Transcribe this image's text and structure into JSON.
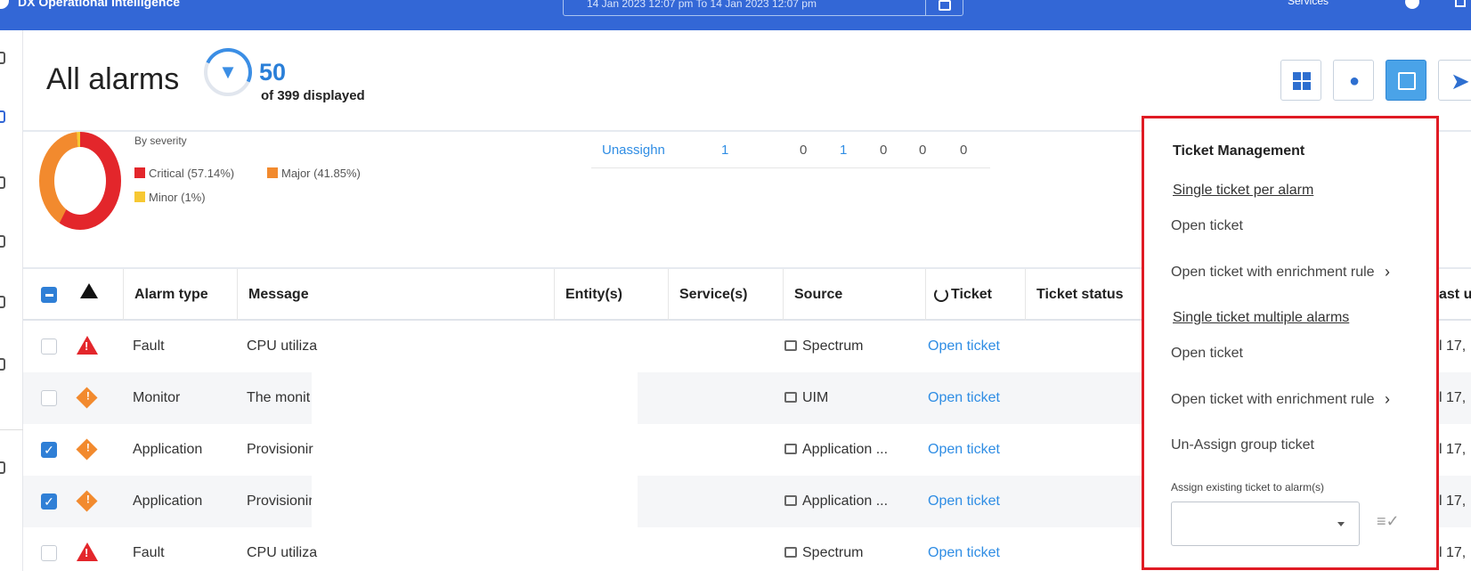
{
  "topbar": {
    "brand": "DX Operational Intelligence",
    "time_range": "14 Jan 2023 12:07 pm    To    14 Jan 2023 12:07 pm",
    "services_link": "Services"
  },
  "header": {
    "title": "All alarms",
    "count": "50",
    "count_caption": "of 399 displayed"
  },
  "summary": {
    "legend_title": "By severity",
    "legend": [
      {
        "label": "Critical (57.14%)",
        "color": "#e3262b"
      },
      {
        "label": "Major (41.85%)",
        "color": "#f28a2e"
      },
      {
        "label": "Minor (1%)",
        "color": "#f7c833"
      }
    ],
    "assign": {
      "label": "Unassighn",
      "values": [
        "1",
        "0",
        "1",
        "0",
        "0",
        "0"
      ]
    }
  },
  "table": {
    "columns": [
      "Alarm type",
      "Message",
      "Entity(s)",
      "Service(s)",
      "Source",
      "Ticket",
      "Ticket status",
      "ast u"
    ],
    "rows": [
      {
        "checked": false,
        "severity": "critical",
        "alarm_type": "Fault",
        "message": "CPU utiliza",
        "source": "Spectrum",
        "ticket": "Open ticket",
        "last": "l 17,"
      },
      {
        "checked": false,
        "severity": "major",
        "alarm_type": "Monitor",
        "message": "The monit",
        "source": "UIM",
        "ticket": "Open ticket",
        "last": "l 17,"
      },
      {
        "checked": true,
        "severity": "major",
        "alarm_type": "Application",
        "message": "Provisionir",
        "source": "Application ...",
        "ticket": "Open ticket",
        "last": "l 17,"
      },
      {
        "checked": true,
        "severity": "major",
        "alarm_type": "Application",
        "message": "Provisionir",
        "source": "Application ...",
        "ticket": "Open ticket",
        "last": "l 17,"
      },
      {
        "checked": false,
        "severity": "critical",
        "alarm_type": "Fault",
        "message": "CPU utiliza",
        "source": "Spectrum",
        "ticket": "Open ticket",
        "last": "l 17,"
      }
    ]
  },
  "ticket_menu": {
    "title": "Ticket Management",
    "section_single": "Single ticket per alarm",
    "open_ticket_1": "Open ticket",
    "open_enrich_1": "Open ticket with enrichment rule",
    "section_multi": "Single ticket multiple alarms",
    "open_ticket_2": "Open ticket",
    "open_enrich_2": "Open ticket with enrichment rule",
    "unassign": "Un-Assign group ticket",
    "assign_label": "Assign existing ticket to alarm(s)",
    "assign_value": ""
  },
  "icons": {
    "filter": "filter-icon",
    "chevron": "chevron-right-icon"
  }
}
